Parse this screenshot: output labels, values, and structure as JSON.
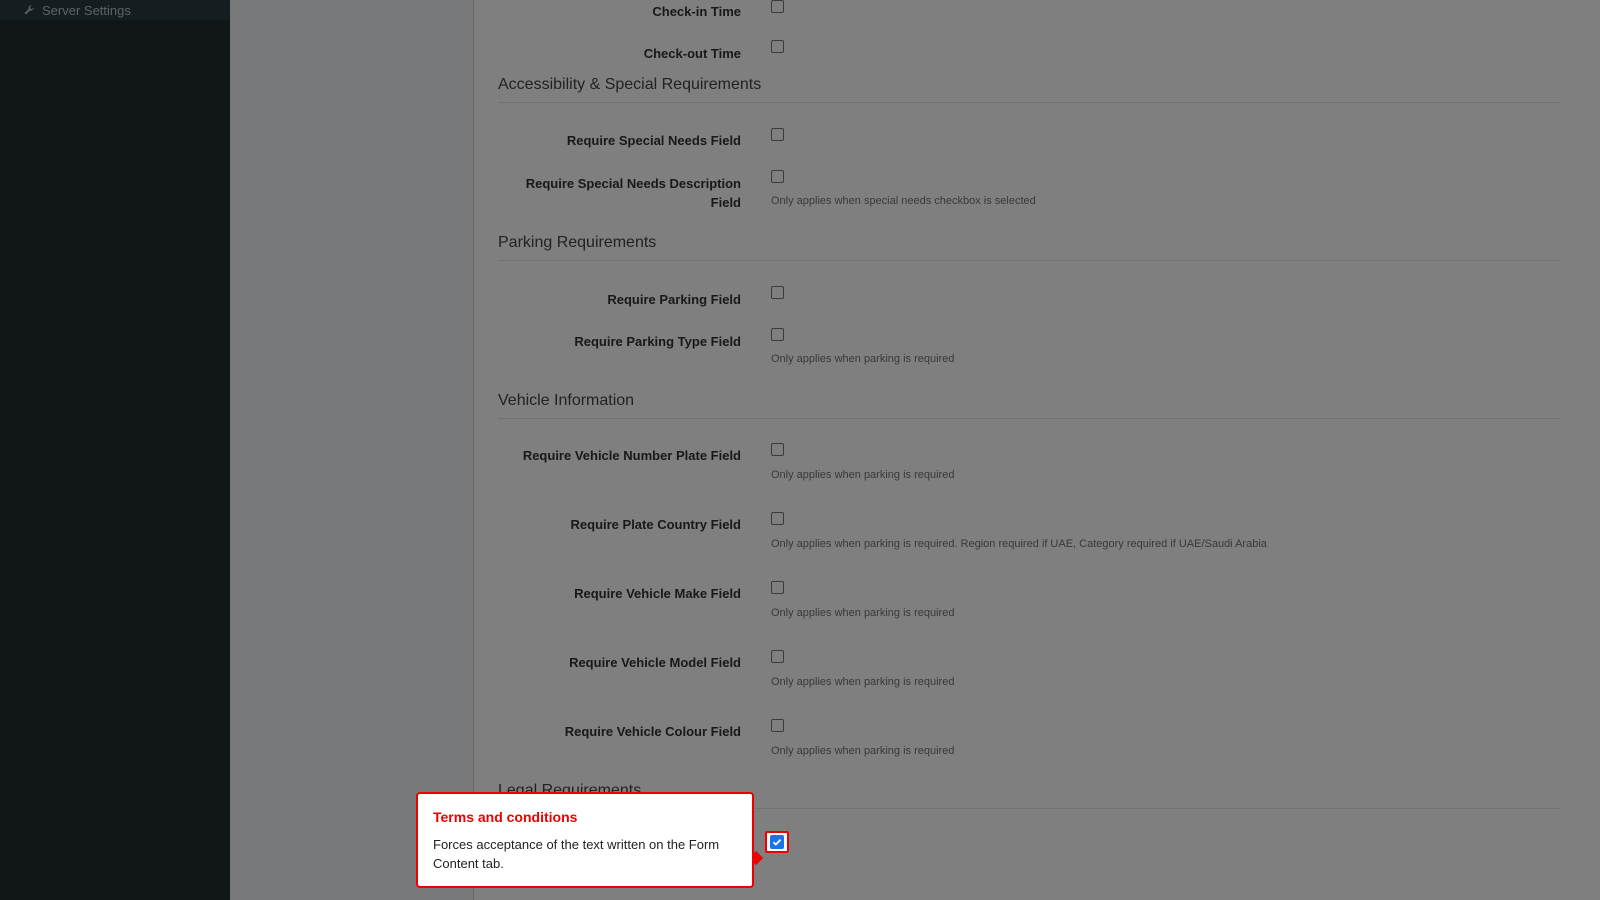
{
  "sidebar": {
    "items": [
      {
        "label": "Server Settings",
        "icon": "wrench-icon"
      }
    ]
  },
  "form": {
    "top_rows": [
      {
        "label": "Check-in Time"
      },
      {
        "label": "Check-out Time"
      }
    ],
    "sections": [
      {
        "title": "Accessibility & Special Requirements",
        "rows": [
          {
            "label": "Require Special Needs Field",
            "help": ""
          },
          {
            "label": "Require Special Needs Description Field",
            "help": "Only applies when special needs checkbox is selected"
          }
        ]
      },
      {
        "title": "Parking Requirements",
        "rows": [
          {
            "label": "Require Parking Field",
            "help": ""
          },
          {
            "label": "Require Parking Type Field",
            "help": "Only applies when parking is required"
          }
        ]
      },
      {
        "title": "Vehicle Information",
        "rows": [
          {
            "label": "Require Vehicle Number Plate Field",
            "help": "Only applies when parking is required"
          },
          {
            "label": "Require Plate Country Field",
            "help": "Only applies when parking is required. Region required if UAE, Category required if UAE/Saudi Arabia"
          },
          {
            "label": "Require Vehicle Make Field",
            "help": "Only applies when parking is required"
          },
          {
            "label": "Require Vehicle Model Field",
            "help": "Only applies when parking is required"
          },
          {
            "label": "Require Vehicle Colour Field",
            "help": "Only applies when parking is required"
          }
        ]
      },
      {
        "title": "Legal Requirements",
        "rows": []
      }
    ]
  },
  "tooltip": {
    "title": "Terms and conditions",
    "body": "Forces acceptance of the text written on the Form Content tab."
  },
  "colors": {
    "highlight": "#ee0000",
    "checkbox_checked": "#1a73e8"
  }
}
